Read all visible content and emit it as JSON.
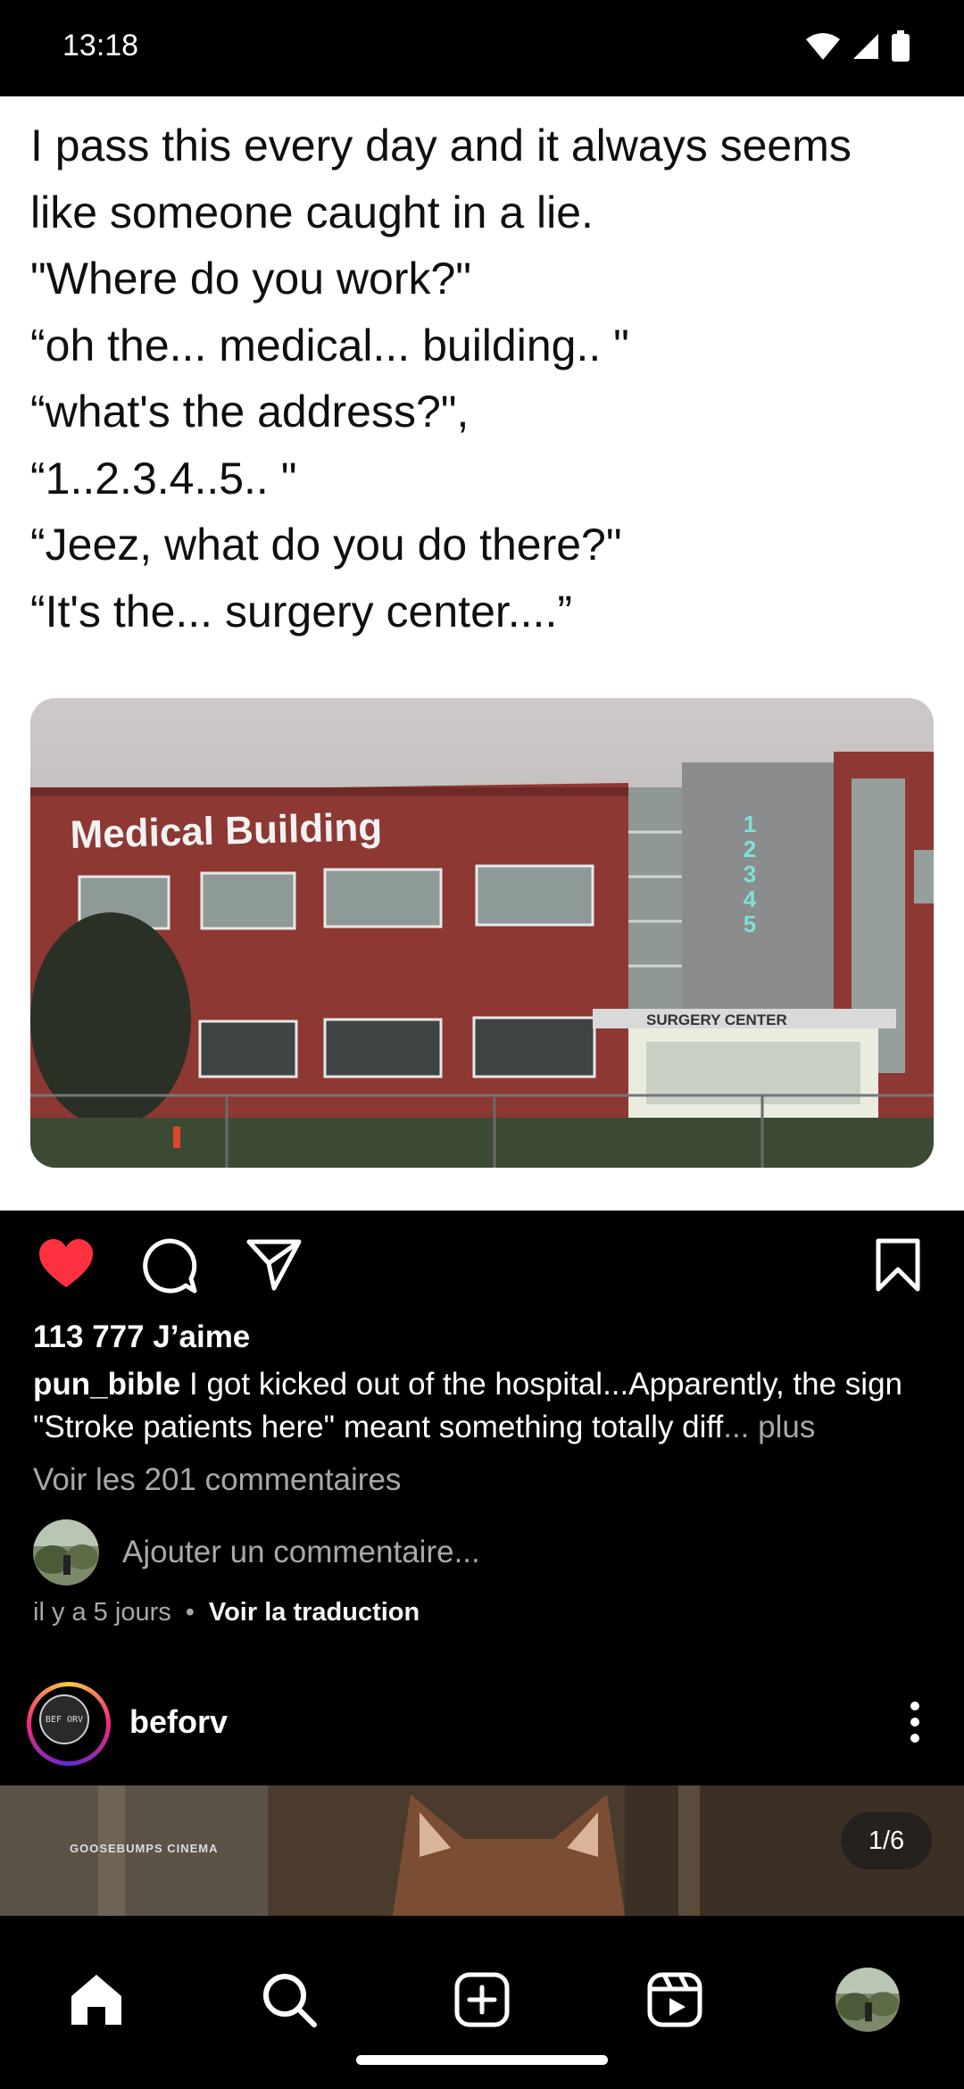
{
  "status_bar": {
    "time": "13:18"
  },
  "post": {
    "text_lines": [
      "I pass this every day and it always seems",
      "like someone caught in a lie.",
      "\"Where do you work?\"",
      "“oh the... medical... building.. \"",
      "“what's the address?\",",
      "“1..2.3.4..5.. \"",
      "“Jeez, what do you do there?\"",
      "“It's the... surgery center....”"
    ],
    "photo": {
      "sign_text": "Medical Building",
      "address_digits": [
        "1",
        "2",
        "3",
        "4",
        "5"
      ],
      "canopy_text": "SURGERY CENTER"
    },
    "likes": "113 777 J’aime",
    "caption_user": "pun_bible",
    "caption_text": " I got kicked out of the hospital...Apparently, the sign \"Stroke patients here\" meant something totally diff",
    "caption_more": "... plus",
    "view_comments": "Voir les 201 commentaires",
    "add_comment_placeholder": "Ajouter un commentaire...",
    "time_ago": "il y a 5 jours",
    "separator": "•",
    "translate": "Voir la traduction",
    "liked": true
  },
  "next_post": {
    "username": "beforv",
    "avatar_text": "BEF ORV",
    "media_watermark": "GOOSEBUMPS CINEMA",
    "counter": "1/6"
  },
  "icons": {
    "like": "heart-filled-icon",
    "comment": "comment-bubble-icon",
    "share": "send-plane-icon",
    "save": "bookmark-icon",
    "nav": [
      "home-icon",
      "search-icon",
      "create-plus-icon",
      "reels-icon",
      "profile-avatar"
    ]
  },
  "colors": {
    "like": "#ff3040",
    "background": "#000000",
    "muted_text": "#a8a8a8"
  }
}
